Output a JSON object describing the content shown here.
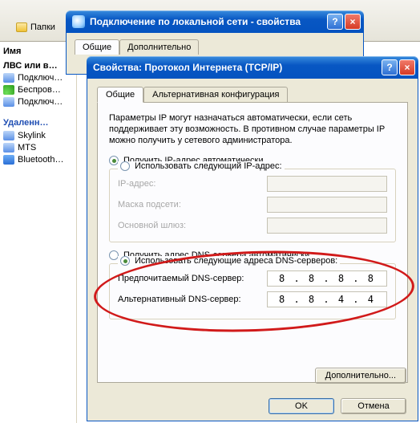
{
  "explorer": {
    "folders_label": "Папки",
    "col_name": "Имя",
    "lvs": "ЛВС или в…",
    "items_top": [
      {
        "label": "Подключ…"
      },
      {
        "label": "Беспров…"
      },
      {
        "label": "Подключ…"
      }
    ],
    "deleted_header": "Удаленн…",
    "items_bottom": [
      {
        "label": "Skylink"
      },
      {
        "label": "MTS"
      },
      {
        "label": "Bluetooth…"
      }
    ]
  },
  "win1": {
    "title": "Подключение по локальной сети - свойства",
    "tabs": [
      {
        "label": "Общие"
      },
      {
        "label": "Дополнительно"
      }
    ]
  },
  "win2": {
    "title": "Свойства: Протокол Интернета (TCP/IP)",
    "tabs": [
      {
        "label": "Общие"
      },
      {
        "label": "Альтернативная конфигурация"
      }
    ],
    "desc": "Параметры IP могут назначаться автоматически, если сеть поддерживает эту возможность. В противном случае параметры IP можно получить у сетевого администратора.",
    "radio_auto_ip": "Получить IP-адрес автоматически",
    "radio_manual_ip": "Использовать следующий IP-адрес:",
    "ip_label": "IP-адрес:",
    "mask_label": "Маска подсети:",
    "gw_label": "Основной шлюз:",
    "radio_auto_dns": "Получить адрес DNS-сервера автоматически",
    "radio_manual_dns": "Использовать следующие адреса DNS-серверов:",
    "dns1_label": "Предпочитаемый DNS-сервер:",
    "dns2_label": "Альтернативный DNS-сервер:",
    "dns1_value": "8 . 8 . 8 . 8",
    "dns2_value": "8 . 8 . 4 . 4",
    "advanced": "Дополнительно...",
    "ok": "OK",
    "cancel": "Отмена"
  }
}
